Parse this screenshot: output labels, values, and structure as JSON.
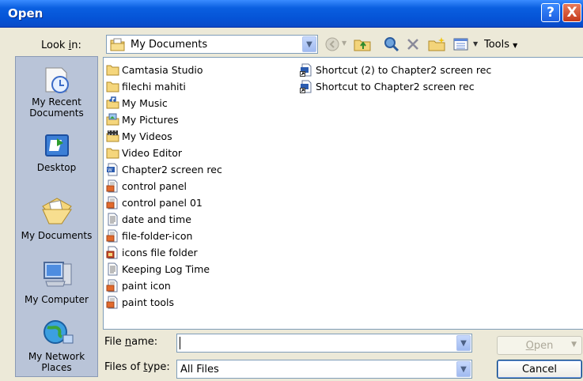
{
  "window": {
    "title": "Open",
    "help_glyph": "?",
    "close_glyph": "X"
  },
  "lookin": {
    "label_pre": "Look ",
    "label_key": "i",
    "label_post": "n:",
    "value": "My Documents",
    "tools_label": "Tools"
  },
  "places": [
    {
      "label": "My Recent Documents",
      "icon": "recent-documents-icon"
    },
    {
      "label": "Desktop",
      "icon": "desktop-icon"
    },
    {
      "label": "My Documents",
      "icon": "my-documents-icon"
    },
    {
      "label": "My Computer",
      "icon": "my-computer-icon"
    },
    {
      "label": "My Network Places",
      "icon": "network-places-icon"
    }
  ],
  "files": [
    {
      "name": "Camtasia Studio",
      "type": "folder"
    },
    {
      "name": "filechi mahiti",
      "type": "folder"
    },
    {
      "name": "My Music",
      "type": "music-folder"
    },
    {
      "name": "My Pictures",
      "type": "pictures-folder"
    },
    {
      "name": "My Videos",
      "type": "videos-folder"
    },
    {
      "name": "Video Editor",
      "type": "folder"
    },
    {
      "name": "Chapter2 screen rec",
      "type": "word-document"
    },
    {
      "name": "control panel",
      "type": "image"
    },
    {
      "name": "control panel 01",
      "type": "image"
    },
    {
      "name": "date and time",
      "type": "text"
    },
    {
      "name": "file-folder-icon",
      "type": "image"
    },
    {
      "name": "icons file folder",
      "type": "image-alt"
    },
    {
      "name": "Keeping Log Time",
      "type": "text"
    },
    {
      "name": "paint icon",
      "type": "image"
    },
    {
      "name": "paint tools",
      "type": "image"
    },
    {
      "name": "Shortcut (2) to Chapter2 screen rec",
      "type": "shortcut"
    },
    {
      "name": "Shortcut to Chapter2 screen rec",
      "type": "shortcut"
    }
  ],
  "filename": {
    "label_pre": "File ",
    "label_key": "n",
    "label_post": "ame:",
    "value": ""
  },
  "filetype": {
    "label_pre": "Files of ",
    "label_key": "t",
    "label_post": "ype:",
    "value": "All Files"
  },
  "buttons": {
    "open_pre": "",
    "open_key": "O",
    "open_post": "pen",
    "cancel": "Cancel"
  }
}
